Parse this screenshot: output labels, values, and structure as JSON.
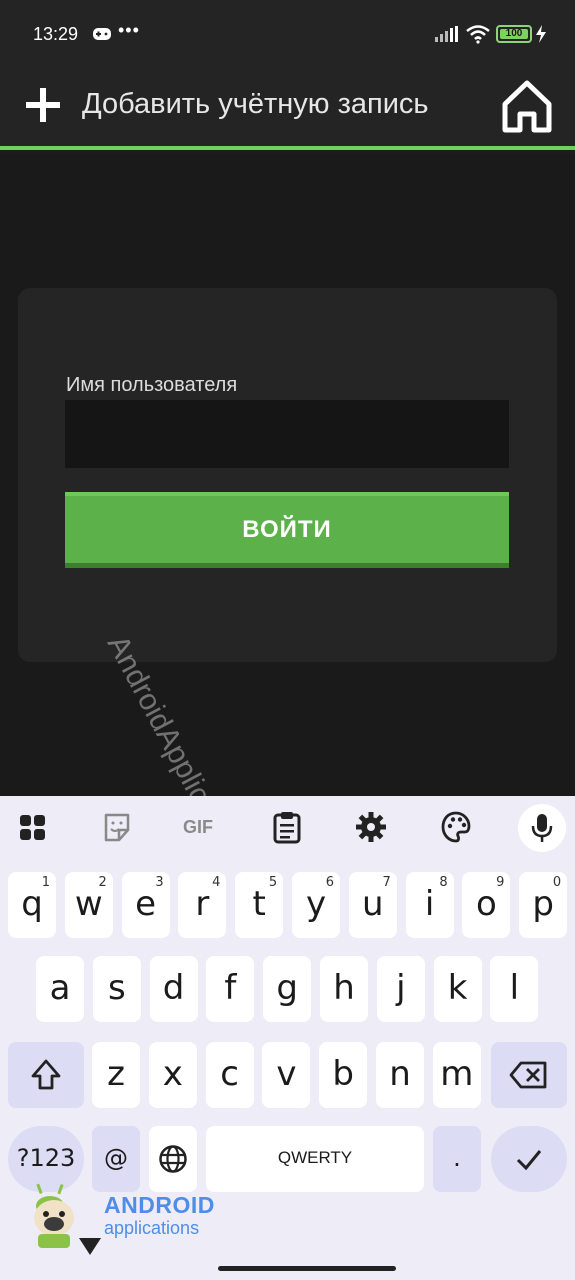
{
  "status_bar": {
    "time": "13:29",
    "more": "•••",
    "battery": "100"
  },
  "app_bar": {
    "title": "Добавить учётную запись",
    "accent_color": "#6cd25a"
  },
  "form": {
    "username_label": "Имя пользователя",
    "username_value": "",
    "login_button": "ВОЙТИ"
  },
  "watermark": "AndroidApplications.STORE",
  "keyboard": {
    "toolbar": [
      "apps-icon",
      "sticker-icon",
      "gif-icon",
      "clipboard-icon",
      "settings-icon",
      "palette-icon",
      "mic-icon"
    ],
    "gif_label": "GIF",
    "row1": [
      {
        "k": "q",
        "h": "1"
      },
      {
        "k": "w",
        "h": "2"
      },
      {
        "k": "e",
        "h": "3"
      },
      {
        "k": "r",
        "h": "4"
      },
      {
        "k": "t",
        "h": "5"
      },
      {
        "k": "y",
        "h": "6"
      },
      {
        "k": "u",
        "h": "7"
      },
      {
        "k": "i",
        "h": "8"
      },
      {
        "k": "o",
        "h": "9"
      },
      {
        "k": "p",
        "h": "0"
      }
    ],
    "row2": [
      "a",
      "s",
      "d",
      "f",
      "g",
      "h",
      "j",
      "k",
      "l"
    ],
    "row3": [
      "z",
      "x",
      "c",
      "v",
      "b",
      "n",
      "m"
    ],
    "symbols_key": "?123",
    "at_key": "@",
    "space_label": "QWERTY",
    "period_key": "."
  },
  "logo": {
    "title": "ANDROID",
    "subtitle": "applications"
  }
}
